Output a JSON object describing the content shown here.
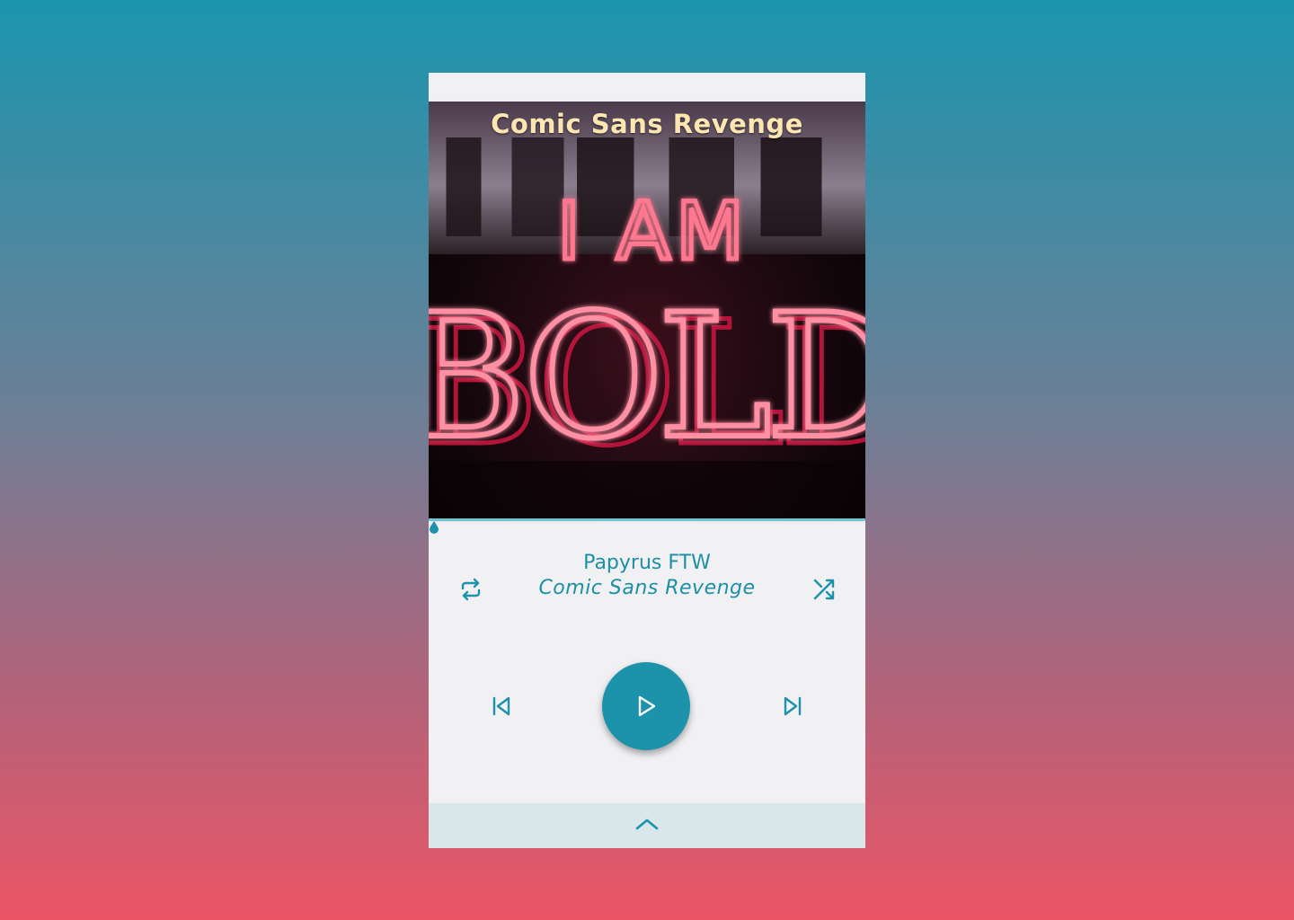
{
  "album": {
    "art_title": "Comic Sans Revenge",
    "neon_line1": "I AM",
    "neon_line2": "BOLD"
  },
  "track": {
    "title": "Papyrus FTW",
    "artist": "Comic Sans Revenge",
    "progress": 0.0
  },
  "controls": {
    "repeat_icon": "repeat-icon",
    "shuffle_icon": "shuffle-icon",
    "prev_icon": "skip-previous-icon",
    "play_icon": "play-icon",
    "next_icon": "skip-next-icon",
    "expand_icon": "chevron-up-icon"
  },
  "colors": {
    "accent": "#1c93ab",
    "neon": "#ff6f8a",
    "title_text": "#fde6b0",
    "background_top": "#1b95ae",
    "background_bottom": "#ec5566"
  }
}
